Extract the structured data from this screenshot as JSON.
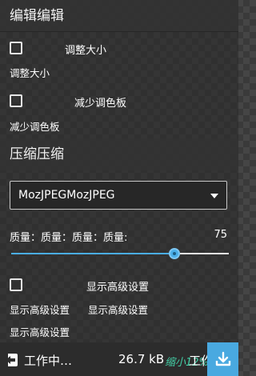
{
  "sections": {
    "edit": {
      "title": "编辑编辑",
      "resize": {
        "inline_label": "调整大小",
        "line_label": "调整大小",
        "checked": false
      },
      "reduce_palette": {
        "inline_label": "减少调色板",
        "line_label": "减少调色板",
        "checked": false
      }
    },
    "compress": {
      "title": "压缩压缩",
      "encoder": {
        "selected": "MozJPEGMozJPEG"
      },
      "quality": {
        "label": "质量：质量：质量：质量:",
        "value": "75",
        "max": 100
      },
      "advanced": {
        "inline_label": "显示高级设置",
        "line1_a": "显示高级设置",
        "line1_b": "显示高级设置",
        "line2": "显示高级设置",
        "checked": false
      }
    }
  },
  "footer": {
    "status": "工作中…",
    "size": "26.7 kB",
    "saving": "缩小12%",
    "status_trailing": "工作",
    "icons": {
      "back": "back-arrow-icon",
      "download": "download-icon"
    }
  },
  "colors": {
    "accent": "#4aaee8",
    "savings": "#44d1a8",
    "download_bg": "#49a9e0"
  }
}
